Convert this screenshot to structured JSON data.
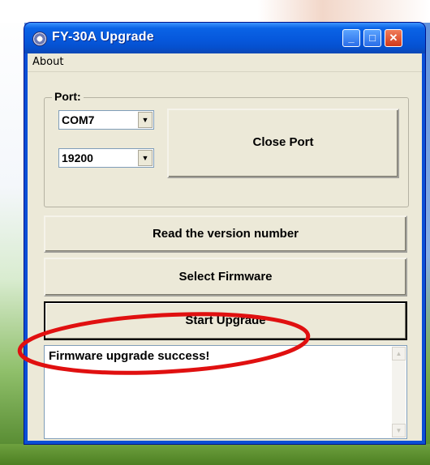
{
  "window": {
    "title": "FY-30A Upgrade",
    "controls": {
      "minimize_icon": "minimize-icon",
      "maximize_icon": "maximize-icon",
      "close_icon": "close-icon"
    }
  },
  "menu": {
    "items": [
      "About"
    ]
  },
  "port": {
    "group_label": "Port:",
    "com_port": "COM7",
    "baud_rate": "19200"
  },
  "buttons": {
    "close_port": "Close Port",
    "read_version": "Read the version number",
    "select_firmware": "Select Firmware",
    "start_upgrade": "Start Upgrade"
  },
  "log": {
    "text": "Firmware upgrade success!"
  },
  "colors": {
    "titlebar": "#0a63e6",
    "client_bg": "#ece9d8",
    "highlight_ellipse": "#e01010"
  }
}
